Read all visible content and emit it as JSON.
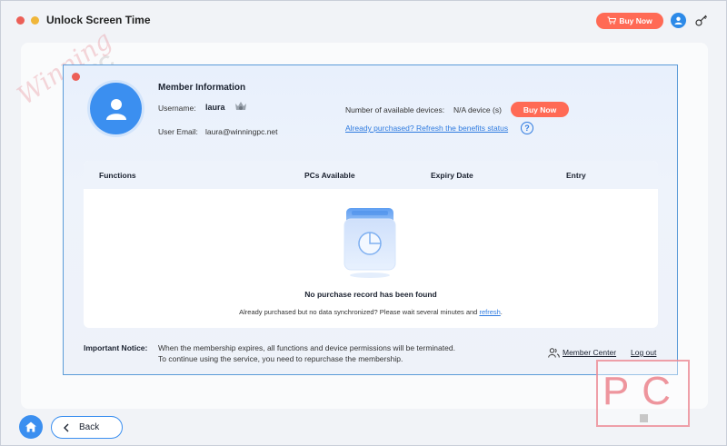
{
  "window": {
    "title": "Unlock Screen Time",
    "buy_now": "Buy Now"
  },
  "member": {
    "title": "Member Information",
    "username_label": "Username:",
    "username_value": "laura",
    "email_label": "User Email:",
    "email_value": "laura@winningpc.net",
    "devices_label": "Number of available devices:",
    "devices_value": "N/A device (s)",
    "buy_now": "Buy Now",
    "refresh_link": "Already purchased? Refresh the benefits status",
    "help": "?"
  },
  "table": {
    "columns": [
      "Functions",
      "PCs Available",
      "Expiry Date",
      "Entry"
    ],
    "empty_title": "No purchase record has been found",
    "empty_sub_prefix": "Already purchased but no data synchronized? Please wait several minutes and",
    "empty_sub_link": "refresh",
    "empty_sub_suffix": "."
  },
  "notice": {
    "label": "Important Notice:",
    "line1": "When the membership expires, all functions and device permissions will be terminated.",
    "line2": "To continue using the service, you need to repurchase the membership.",
    "member_center": "Member Center",
    "logout": "Log out"
  },
  "nav": {
    "back": "Back"
  },
  "watermark": {
    "script_text": "Winning",
    "pc_text": "PC",
    "box_text": "PC"
  },
  "colors": {
    "accent_blue": "#3b8ff0",
    "buy_orange": "#ff6a55",
    "link_blue": "#2f7be0"
  }
}
